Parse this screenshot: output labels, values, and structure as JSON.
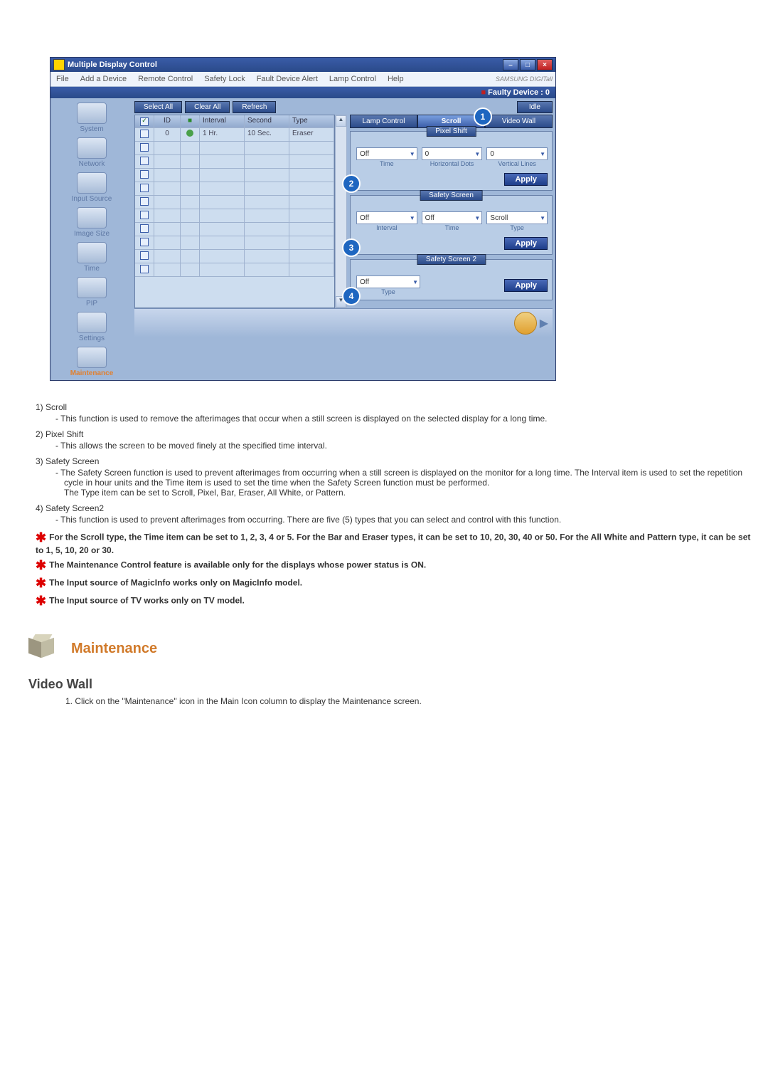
{
  "window": {
    "title": "Multiple Display Control",
    "brand": "SAMSUNG DIGITall",
    "faulty": "Faulty Device : 0",
    "menu": [
      "File",
      "Add a Device",
      "Remote Control",
      "Safety Lock",
      "Fault Device Alert",
      "Lamp Control",
      "Help"
    ],
    "win_buttons": {
      "min": "–",
      "max": "□",
      "close": "×"
    }
  },
  "toolbar": {
    "select_all": "Select All",
    "clear_all": "Clear All",
    "refresh": "Refresh",
    "idle": "Idle"
  },
  "sidebar": {
    "items": [
      {
        "label": "System"
      },
      {
        "label": "Network"
      },
      {
        "label": "Input Source"
      },
      {
        "label": "Image Size"
      },
      {
        "label": "Time"
      },
      {
        "label": "PIP"
      },
      {
        "label": "Settings"
      },
      {
        "label": "Maintenance"
      }
    ]
  },
  "grid": {
    "headers": {
      "id": "ID",
      "interval": "Interval",
      "second": "Second",
      "type": "Type"
    },
    "row0": {
      "id": "0",
      "interval": "1  Hr.",
      "second": "10 Sec.",
      "type": "Eraser"
    }
  },
  "tabs": {
    "lamp": "Lamp Control",
    "scroll": "Scroll",
    "video": "Video Wall"
  },
  "callouts": {
    "c1": "1",
    "c2": "2",
    "c3": "3",
    "c4": "4"
  },
  "pixel_shift": {
    "title": "Pixel Shift",
    "sel1": "Off",
    "val2": "0",
    "val3": "0",
    "lbl1": "Time",
    "lbl2": "Horizontal Dots",
    "lbl3": "Vertical Lines",
    "apply": "Apply"
  },
  "safety_screen": {
    "title": "Safety Screen",
    "sel1": "Off",
    "sel2": "Off",
    "sel3": "Scroll",
    "lbl1": "Interval",
    "lbl2": "Time",
    "lbl3": "Type",
    "apply": "Apply"
  },
  "safety_screen2": {
    "title": "Safety Screen 2",
    "sel1": "Off",
    "lbl1": "Type",
    "apply": "Apply"
  },
  "notes": {
    "n1_t": "1) Scroll",
    "n1_d": "- This function is used to remove the afterimages that occur when a still screen is displayed on the selected display for a long time.",
    "n2_t": "2) Pixel Shift",
    "n2_d": "- This allows the screen to be moved finely at the specified time interval.",
    "n3_t": "3) Safety Screen",
    "n3_d": "- The Safety Screen function is used to prevent afterimages from occurring when a still screen is displayed on the monitor for a long time.  The Interval item is used to set the repetition cycle in hour units and the Time item is used to set the time when the Safety Screen function must be performed.\nThe Type item can be set to Scroll, Pixel, Bar, Eraser, All White, or Pattern.",
    "n4_t": "4) Safety Screen2",
    "n4_d": "- This function is used to prevent afterimages from occurring. There are five (5) types that you can select and control with this function.",
    "s1": "For the Scroll type, the Time item can be set to 1, 2, 3, 4 or 5. For the Bar and Eraser types, it can be set to 10, 20, 30, 40 or 50. For the All White and Pattern type, it can be set to 1, 5, 10, 20 or 30.",
    "s2": "The Maintenance Control feature is available only for the displays whose power status is ON.",
    "s3": "The Input source of MagicInfo works only on MagicInfo model.",
    "s4": "The Input source of TV works only on TV model."
  },
  "section": {
    "title": "Maintenance",
    "sub": "Video Wall",
    "step1": "1. Click on the \"Maintenance\" icon in the Main Icon column to display the Maintenance screen."
  }
}
